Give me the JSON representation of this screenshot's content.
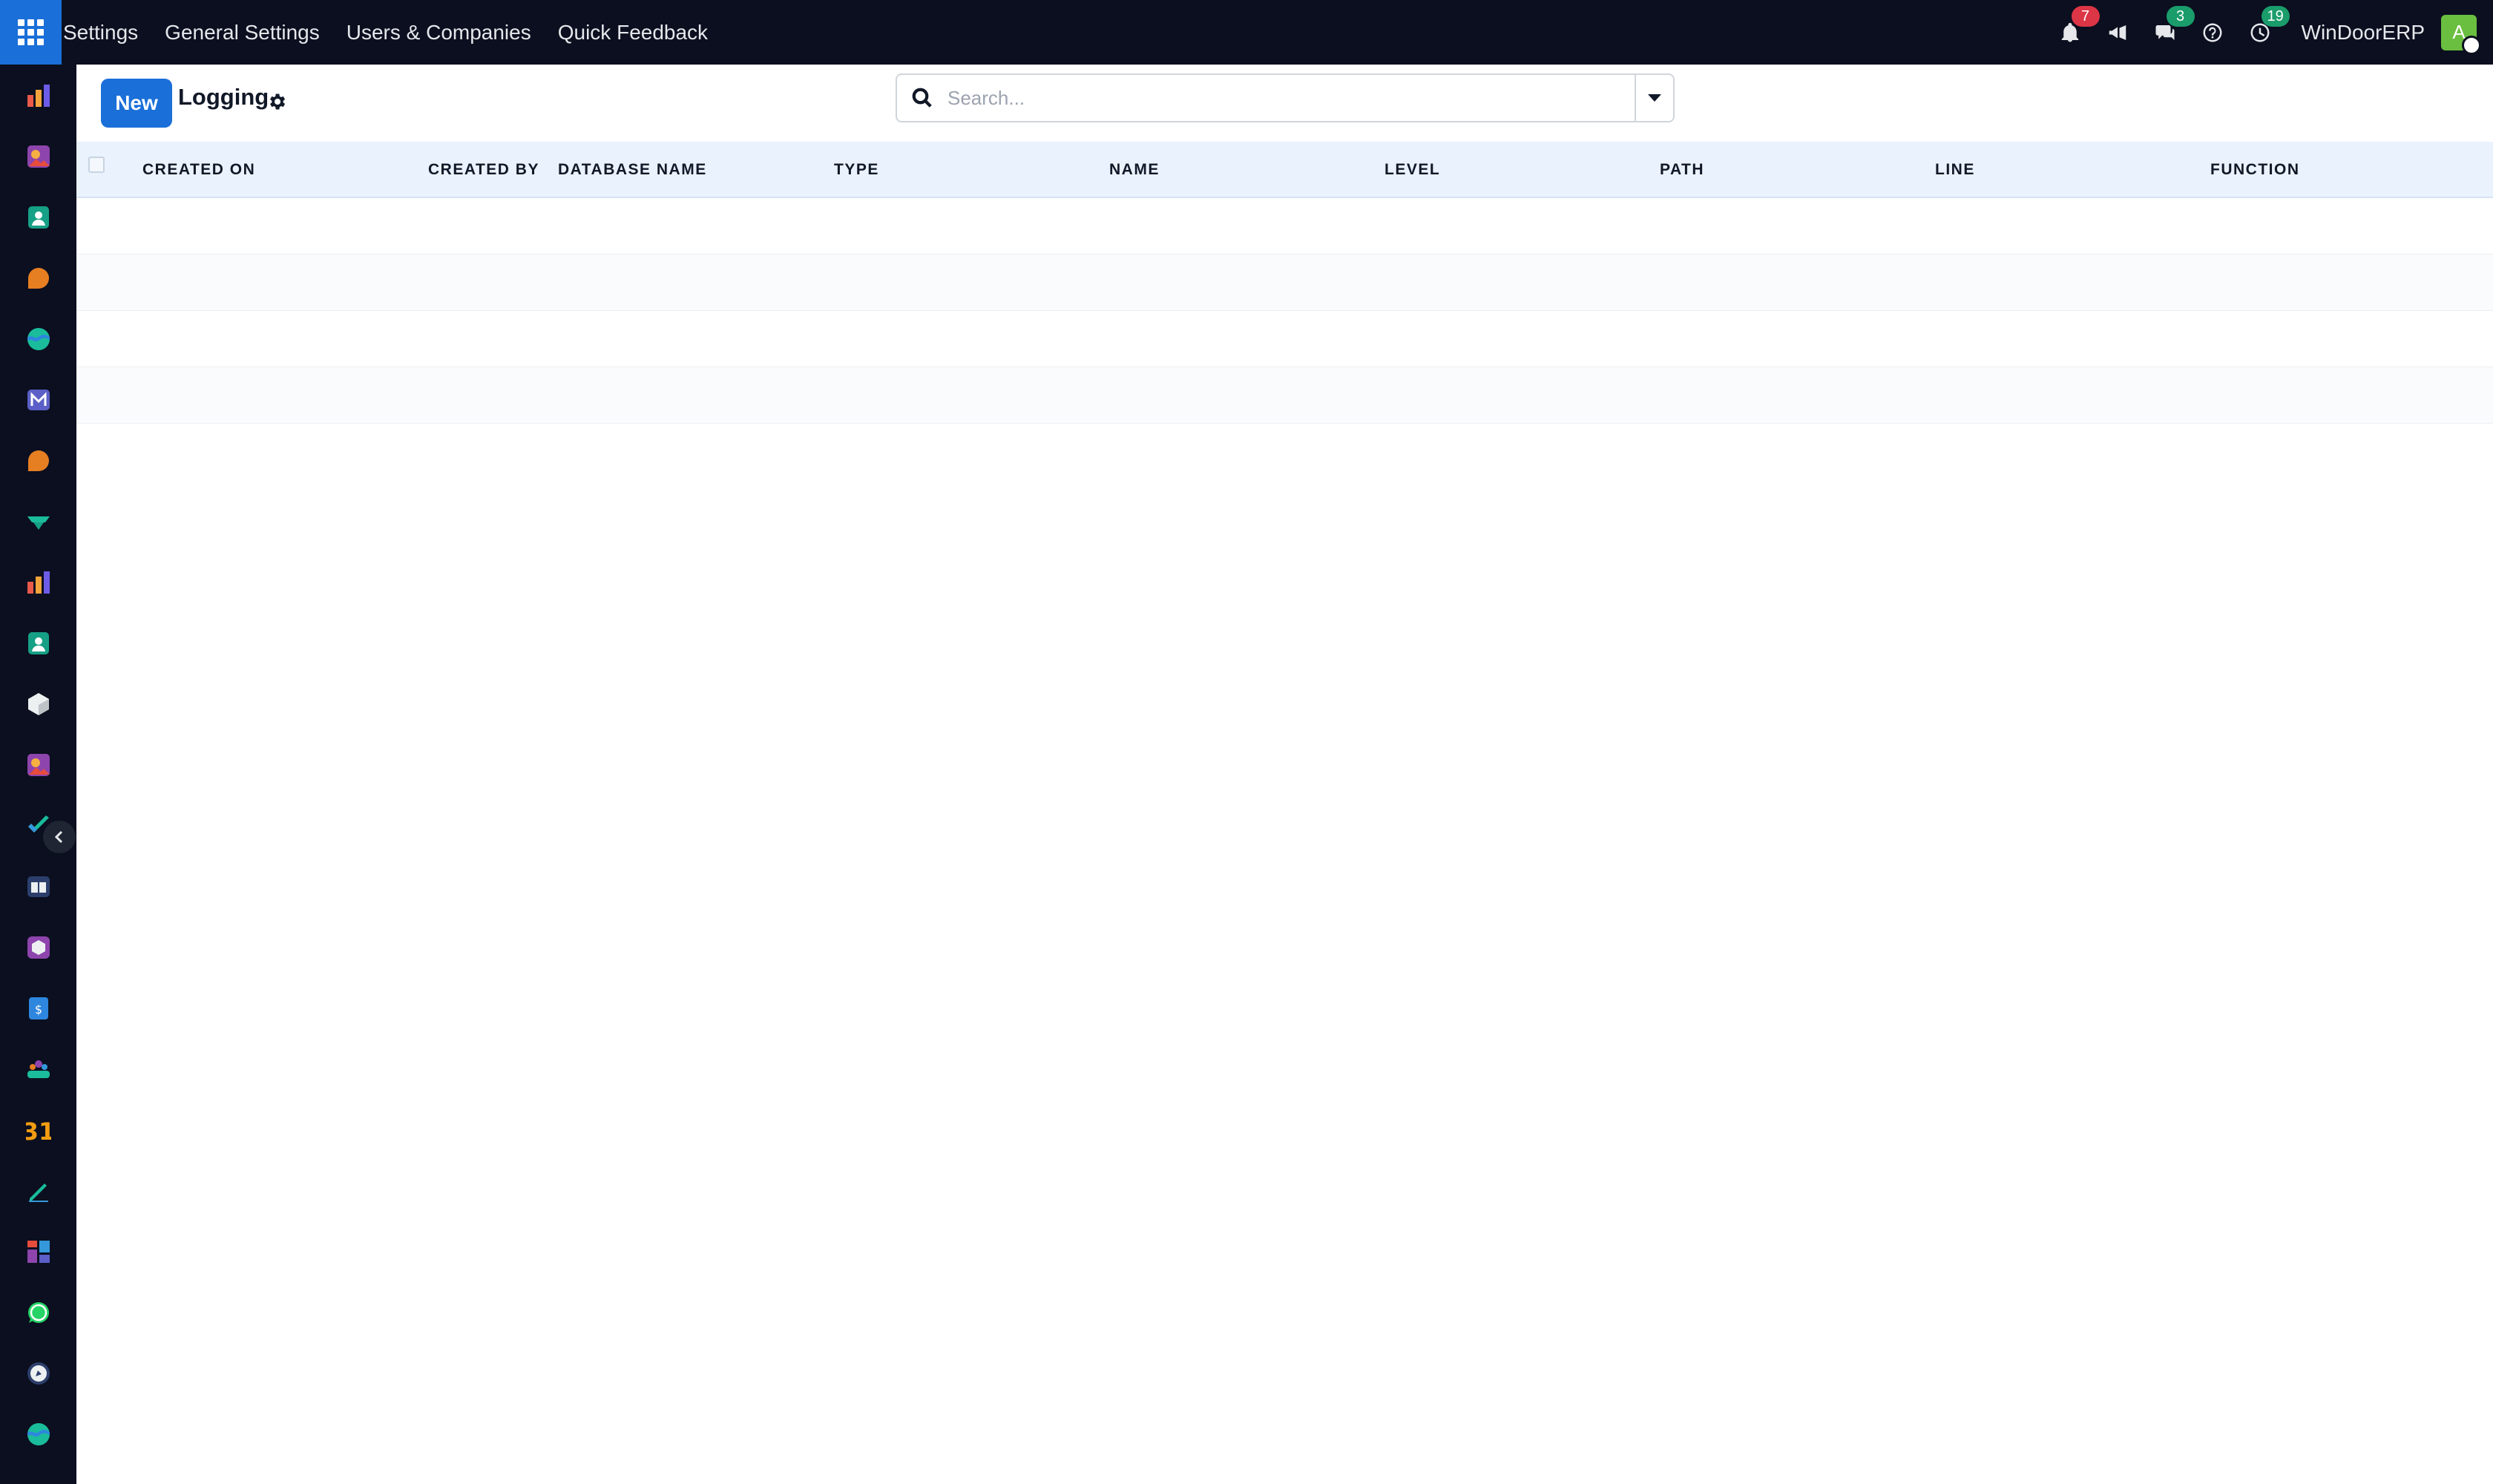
{
  "topbar": {
    "menu": [
      "Settings",
      "General Settings",
      "Users & Companies",
      "Quick Feedback"
    ],
    "badges": {
      "notifications": "7",
      "messages": "3",
      "activities": "19"
    },
    "company": "WinDoorERP",
    "avatar_letter": "A",
    "colors": {
      "background": "#0b0f1f",
      "app_button": "#1a6fd8",
      "badge_red": "#dc3545",
      "badge_green": "#1a9c6b",
      "avatar": "#6abf40"
    }
  },
  "sidebar": {
    "apps": [
      "bar-chart-icon",
      "image-edit-icon",
      "contacts-icon",
      "chat-bubble-icon",
      "wave-icon",
      "mail-icon",
      "chat-bubble-icon",
      "check-ribbon-icon",
      "bar-chart-icon",
      "contacts-icon",
      "cube-icon",
      "image-edit-icon",
      "checkmark-icon",
      "book-icon",
      "box-icon",
      "invoice-icon",
      "team-icon",
      "calendar-icon",
      "pen-icon",
      "dashboard-icon",
      "whatsapp-icon",
      "compass-icon",
      "wave-icon"
    ]
  },
  "control": {
    "new_label": "New",
    "title": "Logging",
    "search_placeholder": "Search..."
  },
  "table": {
    "columns": [
      "CREATED ON",
      "CREATED BY",
      "DATABASE NAME",
      "TYPE",
      "NAME",
      "LEVEL",
      "PATH",
      "LINE",
      "FUNCTION"
    ],
    "rows": [],
    "empty_row_count": 4
  }
}
